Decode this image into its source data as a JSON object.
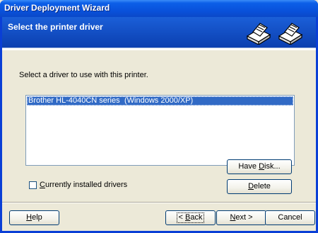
{
  "window": {
    "title": "Driver Deployment Wizard"
  },
  "header": {
    "title": "Select the printer driver",
    "icons": [
      "printer-icon",
      "printer-icon"
    ]
  },
  "main": {
    "instruction": "Select a driver to use with this printer.",
    "drivers": [
      {
        "name": "Brother HL-4040CN series",
        "platform": "(Windows 2000/XP)",
        "selected": true
      }
    ],
    "checkbox": {
      "label_prefix": "",
      "label_mnemonic": "C",
      "label_rest": "urrently installed drivers",
      "checked": false
    }
  },
  "buttons": {
    "have_disk": {
      "pre": "Have ",
      "mn": "D",
      "post": "isk..."
    },
    "delete": {
      "pre": "",
      "mn": "D",
      "post": "elete"
    },
    "help": {
      "pre": "",
      "mn": "H",
      "post": "elp"
    },
    "back": {
      "pre": "< ",
      "mn": "B",
      "post": "ack"
    },
    "next": {
      "pre": "",
      "mn": "N",
      "post": "ext >"
    },
    "cancel": {
      "pre": "Cancel",
      "mn": "",
      "post": ""
    }
  },
  "colors": {
    "title_bar": "#0a49c8",
    "header": "#0b3fb0",
    "selection": "#316ac5",
    "dialog_bg": "#ece9d8"
  }
}
